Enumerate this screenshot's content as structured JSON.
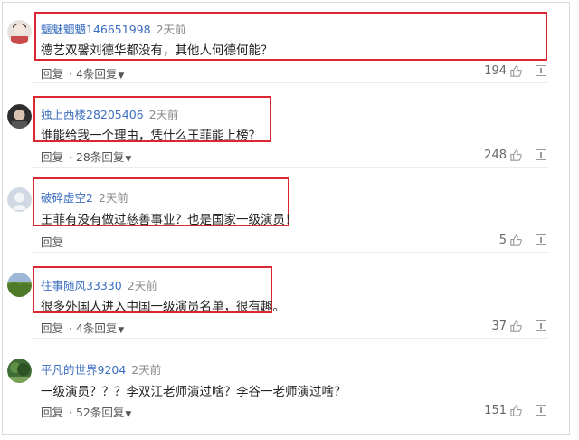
{
  "comments": [
    {
      "username": "魑魅魍魉146651998",
      "time": "2天前",
      "text": "德艺双馨刘德华都没有，其他人何德何能？",
      "reply": "回复",
      "reply_more": "· 4条回复",
      "likes": "194",
      "highlighted": true
    },
    {
      "username": "独上西楼28205406",
      "time": "2天前",
      "text": "谁能给我一个理由，凭什么王菲能上榜？",
      "reply": "回复",
      "reply_more": "· 28条回复",
      "likes": "248",
      "highlighted": true
    },
    {
      "username": "破碎虚空2",
      "time": "2天前",
      "text": "王菲有没有做过慈善事业？也是国家一级演员！",
      "reply": "回复",
      "reply_more": "",
      "likes": "5",
      "highlighted": true
    },
    {
      "username": "往事随风33330",
      "time": "2天前",
      "text": "很多外国人进入中国一级演员名单，很有趣。",
      "reply": "回复",
      "reply_more": "· 4条回复",
      "likes": "37",
      "highlighted": true
    },
    {
      "username": "平凡的世界9204",
      "time": "2天前",
      "text": "一级演员？？？李双江老师演过啥？李谷一老师演过啥？",
      "reply": "回复",
      "reply_more": "· 52条回复",
      "likes": "151",
      "highlighted": false
    }
  ],
  "colors": {
    "username": "#3b6ec0",
    "highlight_box": "#d9282f",
    "meta": "#8a8a8a"
  },
  "icons": [
    "avatar",
    "thumb-up-icon",
    "report-icon",
    "chevron-down-icon"
  ]
}
